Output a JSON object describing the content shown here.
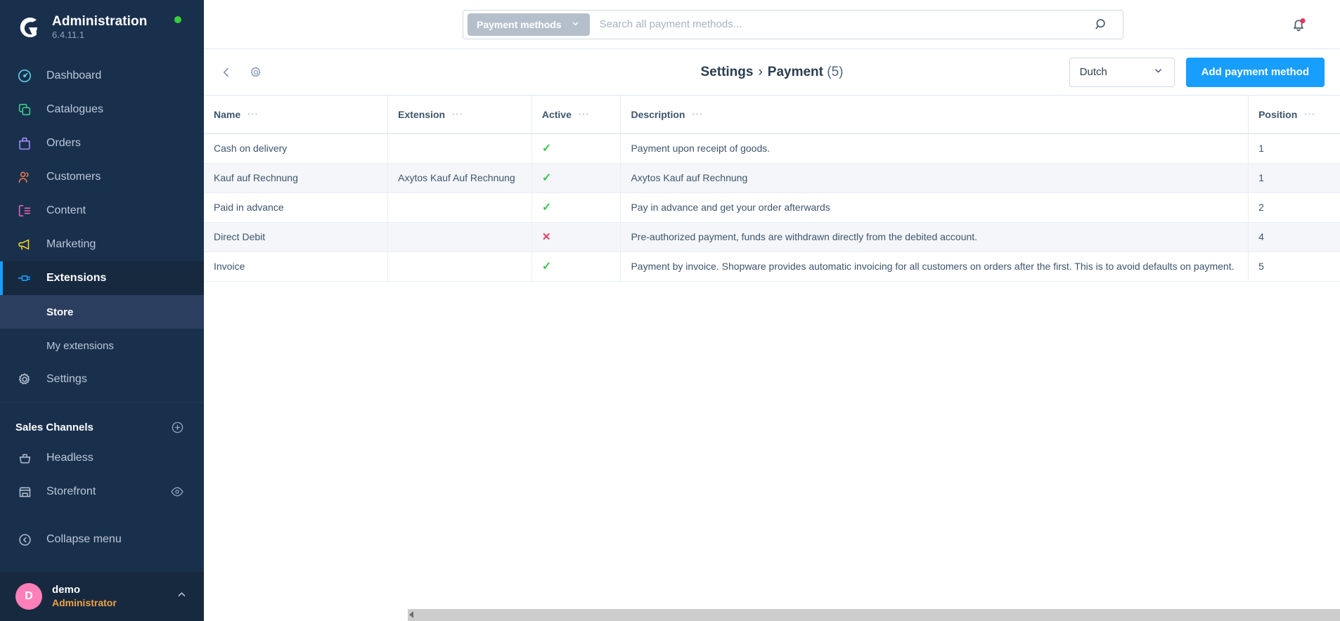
{
  "colors": {
    "sidebar_bg": "#19304d",
    "sidebar_active": "#2b3e60",
    "accent": "#189eff",
    "success": "#3ec455",
    "danger": "#e5406a",
    "avatar": "#ff7fb9",
    "role": "#f0a245",
    "status_dot": "#37d039"
  },
  "brand": {
    "logo_icon": "shopware-logo-icon",
    "title": "Administration",
    "version": "6.4.11.1",
    "status_dot_icon": "status-dot-icon"
  },
  "sidebar": {
    "items": [
      {
        "label": "Dashboard",
        "icon": "dashboard-icon"
      },
      {
        "label": "Catalogues",
        "icon": "catalogues-icon"
      },
      {
        "label": "Orders",
        "icon": "orders-icon"
      },
      {
        "label": "Customers",
        "icon": "customers-icon"
      },
      {
        "label": "Content",
        "icon": "content-icon"
      },
      {
        "label": "Marketing",
        "icon": "marketing-icon"
      },
      {
        "label": "Extensions",
        "icon": "extensions-icon"
      }
    ],
    "sub_items": [
      {
        "label": "Store"
      },
      {
        "label": "My extensions"
      }
    ],
    "settings": {
      "label": "Settings",
      "icon": "gear-icon"
    },
    "sales_channels": {
      "title": "Sales Channels",
      "add_icon": "plus-circle-icon",
      "items": [
        {
          "label": "Headless",
          "icon": "basket-icon"
        },
        {
          "label": "Storefront",
          "icon": "storefront-icon",
          "trailing_icon": "eye-icon"
        }
      ]
    },
    "collapse": {
      "label": "Collapse menu",
      "icon": "collapse-icon"
    },
    "user": {
      "avatar_initial": "D",
      "name": "demo",
      "role": "Administrator",
      "caret_icon": "chevron-up-icon"
    }
  },
  "topbar": {
    "search": {
      "chip_label": "Payment methods",
      "chip_caret_icon": "chevron-down-icon",
      "placeholder": "Search all payment methods...",
      "value": "",
      "search_icon": "search-icon"
    },
    "notifications": {
      "icon": "bell-icon",
      "has_badge": true
    }
  },
  "pagehead": {
    "back_icon": "chevron-left-icon",
    "settings_icon": "gear-icon",
    "breadcrumb": {
      "parent": "Settings",
      "separator": "›",
      "current": "Payment",
      "count": "(5)"
    },
    "language": {
      "value": "Dutch",
      "caret_icon": "chevron-down-icon"
    },
    "add_button": "Add payment method"
  },
  "table": {
    "columns": [
      {
        "label": "Name",
        "dots": "···",
        "sorted": false
      },
      {
        "label": "Extension",
        "dots": "···",
        "sorted": false
      },
      {
        "label": "Active",
        "dots": "···",
        "sorted": false
      },
      {
        "label": "Description",
        "dots": "···",
        "sorted": false
      },
      {
        "label": "Position",
        "dots": "···",
        "sorted": true,
        "sort_dir": "asc"
      }
    ],
    "settings_button_icon": "list-settings-icon",
    "row_action_icon": "•••",
    "active_true_glyph": "✓",
    "active_false_glyph": "✕",
    "rows": [
      {
        "name": "Cash on delivery",
        "extension": "",
        "active": true,
        "description": "Payment upon receipt of goods.",
        "position": "1",
        "up_disabled": true,
        "down_disabled": false
      },
      {
        "name": "Kauf auf Rechnung",
        "extension": "Axytos Kauf Auf Rechnung",
        "active": true,
        "description": "Axytos Kauf auf Rechnung",
        "position": "1",
        "up_disabled": true,
        "down_disabled": false
      },
      {
        "name": "Paid in advance",
        "extension": "",
        "active": true,
        "description": "Pay in advance and get your order afterwards",
        "position": "2",
        "up_disabled": false,
        "down_disabled": false
      },
      {
        "name": "Direct Debit",
        "extension": "",
        "active": false,
        "description": "Pre-authorized payment, funds are withdrawn directly from the debited account.",
        "position": "4",
        "up_disabled": false,
        "down_disabled": false
      },
      {
        "name": "Invoice",
        "extension": "",
        "active": true,
        "description": "Payment by invoice. Shopware provides automatic invoicing for all customers on orders after the first. This is to avoid defaults on payment.",
        "position": "5",
        "up_disabled": false,
        "down_disabled": true
      }
    ]
  }
}
